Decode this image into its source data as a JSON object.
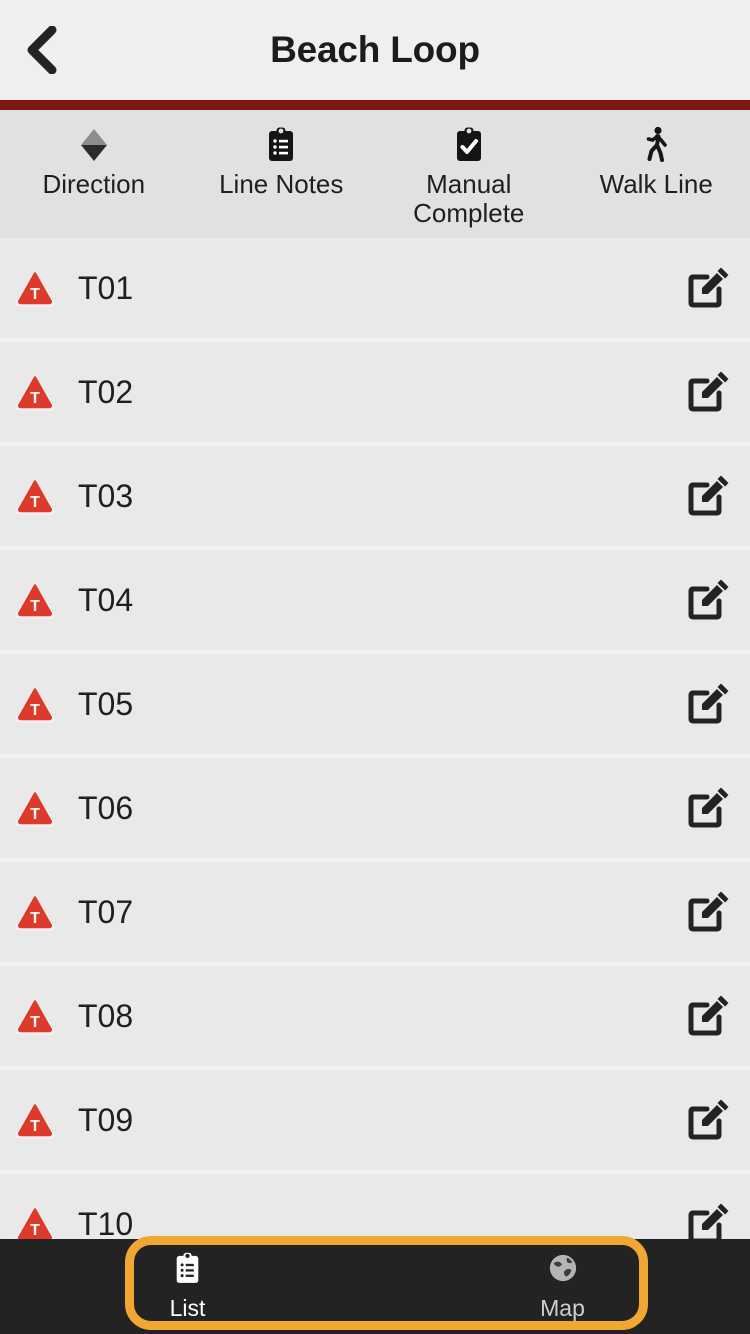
{
  "header": {
    "title": "Beach Loop",
    "back_icon": "chevron-left-icon",
    "rule_color": "#7d1813"
  },
  "toolbar": {
    "items": [
      {
        "label": "Direction",
        "icon": "diamond-direction-icon"
      },
      {
        "label": "Line\nNotes",
        "icon": "clipboard-list-icon"
      },
      {
        "label": "Manual\nComplete",
        "icon": "clipboard-check-icon"
      },
      {
        "label": "Walk\nLine",
        "icon": "walking-person-icon"
      }
    ]
  },
  "list": {
    "warning_icon": "warning-triangle-t-icon",
    "edit_icon": "edit-pencil-square-icon",
    "rows": [
      {
        "label": "T01"
      },
      {
        "label": "T02"
      },
      {
        "label": "T03"
      },
      {
        "label": "T04"
      },
      {
        "label": "T05"
      },
      {
        "label": "T06"
      },
      {
        "label": "T07"
      },
      {
        "label": "T08"
      },
      {
        "label": "T09"
      },
      {
        "label": "T10"
      }
    ]
  },
  "tabbar": {
    "tabs": [
      {
        "label": "List",
        "icon": "clipboard-list-icon",
        "active": true
      },
      {
        "label": "Map",
        "icon": "globe-icon",
        "active": false
      }
    ],
    "background": "#232323"
  },
  "focus_highlight": {
    "color": "#f0a833"
  }
}
